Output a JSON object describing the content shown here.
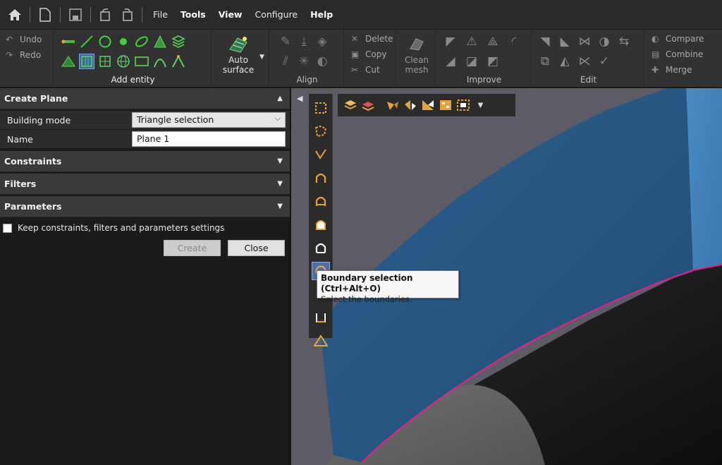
{
  "menu": {
    "items": [
      "File",
      "Tools",
      "View",
      "Configure",
      "Help"
    ]
  },
  "ribbon": {
    "undo_label": "Undo",
    "redo_label": "Redo",
    "add_entity_label": "Add entity",
    "auto_surface_line1": "Auto",
    "auto_surface_line2": "surface",
    "align_label": "Align",
    "delete_label": "Delete",
    "copy_label": "Copy",
    "cut_label": "Cut",
    "clean_mesh_line1": "Clean",
    "clean_mesh_line2": "mesh",
    "improve_label": "Improve",
    "edit_label": "Edit",
    "compare_label": "Compare",
    "combine_label": "Combine",
    "merge_label": "Merge"
  },
  "panel": {
    "title": "Create Plane",
    "building_mode_label": "Building mode",
    "building_mode_value": "Triangle selection",
    "name_label": "Name",
    "name_value": "Plane 1",
    "constraints_label": "Constraints",
    "filters_label": "Filters",
    "parameters_label": "Parameters",
    "keep_settings_label": "Keep constraints, filters and parameters settings",
    "create_label": "Create",
    "close_label": "Close"
  },
  "tooltip": {
    "title": "Boundary selection (Ctrl+Alt+O)",
    "description": "Select the boundaries."
  },
  "colors": {
    "accent_orange": "#e8a23c",
    "selection_blue": "#2f6596",
    "boundary_magenta": "#e0208c"
  }
}
